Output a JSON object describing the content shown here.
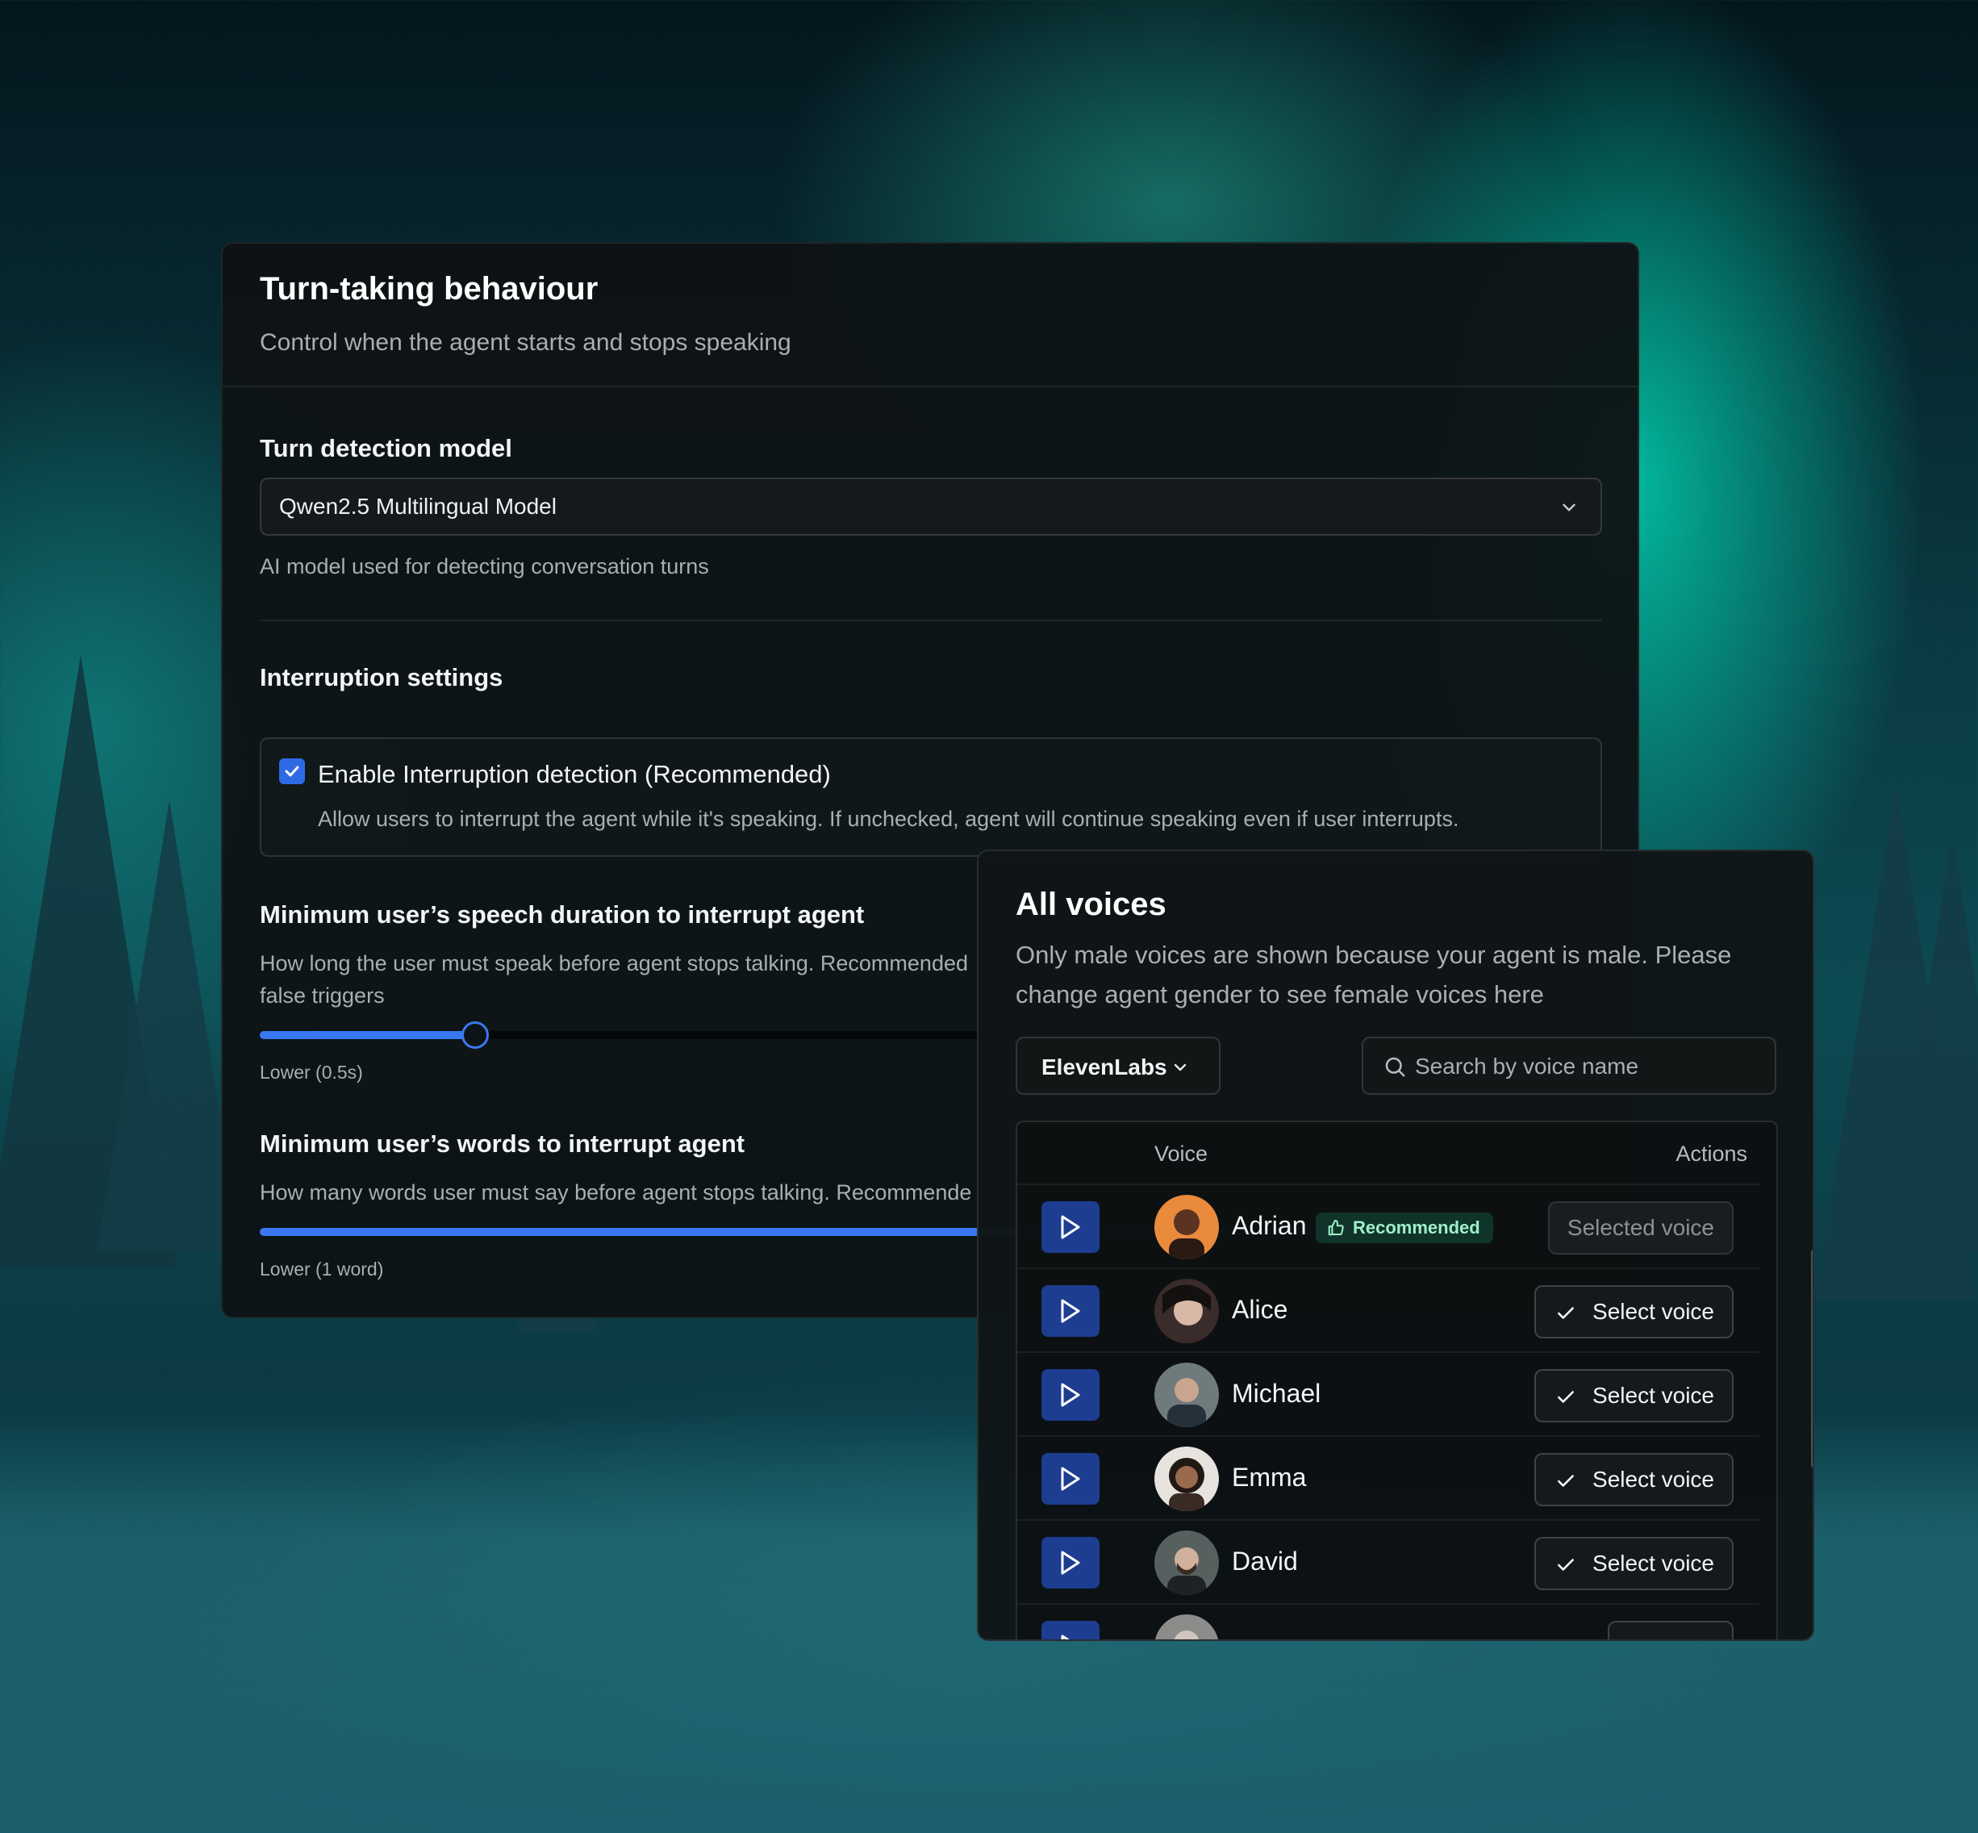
{
  "turn_taking": {
    "title": "Turn-taking behaviour",
    "subtitle": "Control when the agent starts and stops speaking",
    "model_label": "Turn detection model",
    "model_value": "Qwen2.5 Multilingual Model",
    "model_helper": "AI model used for detecting conversation turns",
    "interruption_heading": "Interruption settings",
    "interruption_checkbox": {
      "checked": true,
      "label": "Enable Interruption detection (Recommended)",
      "description": "Allow users to interrupt the agent while it's speaking. If unchecked, agent will continue speaking even if user interrupts."
    },
    "speech_duration": {
      "label": "Minimum user’s speech duration to interrupt agent",
      "helper_line1": "How long the user must speak before agent stops talking. Recommended",
      "helper_line2": "false triggers",
      "min_label": "Lower (0.5s)",
      "level_fraction": 0.16
    },
    "min_words": {
      "label": "Minimum user’s words to interrupt agent",
      "helper": "How many words user must say before agent stops talking. Recommende",
      "min_label": "Lower (1 word)",
      "level_fraction": 0.9
    }
  },
  "voices": {
    "title": "All voices",
    "description": "Only male voices are shown because your agent is male. Please change  agent gender to see female voices here",
    "provider": "ElevenLabs",
    "search_placeholder": "Search by voice name",
    "columns": {
      "voice": "Voice",
      "actions": "Actions"
    },
    "rows": [
      {
        "name": "Adrian",
        "badge": "Recommended",
        "action": "Selected voice",
        "selected": true
      },
      {
        "name": "Alice",
        "action": "Select voice",
        "selected": false
      },
      {
        "name": "Michael",
        "action": "Select voice",
        "selected": false
      },
      {
        "name": "Emma",
        "action": "Select voice",
        "selected": false
      },
      {
        "name": "David",
        "action": "Select voice",
        "selected": false
      }
    ]
  },
  "colors": {
    "accent": "#3a78f2",
    "play_button": "#1d3d91",
    "badge_bg": "#10342a",
    "badge_text": "#9ff0c8"
  }
}
